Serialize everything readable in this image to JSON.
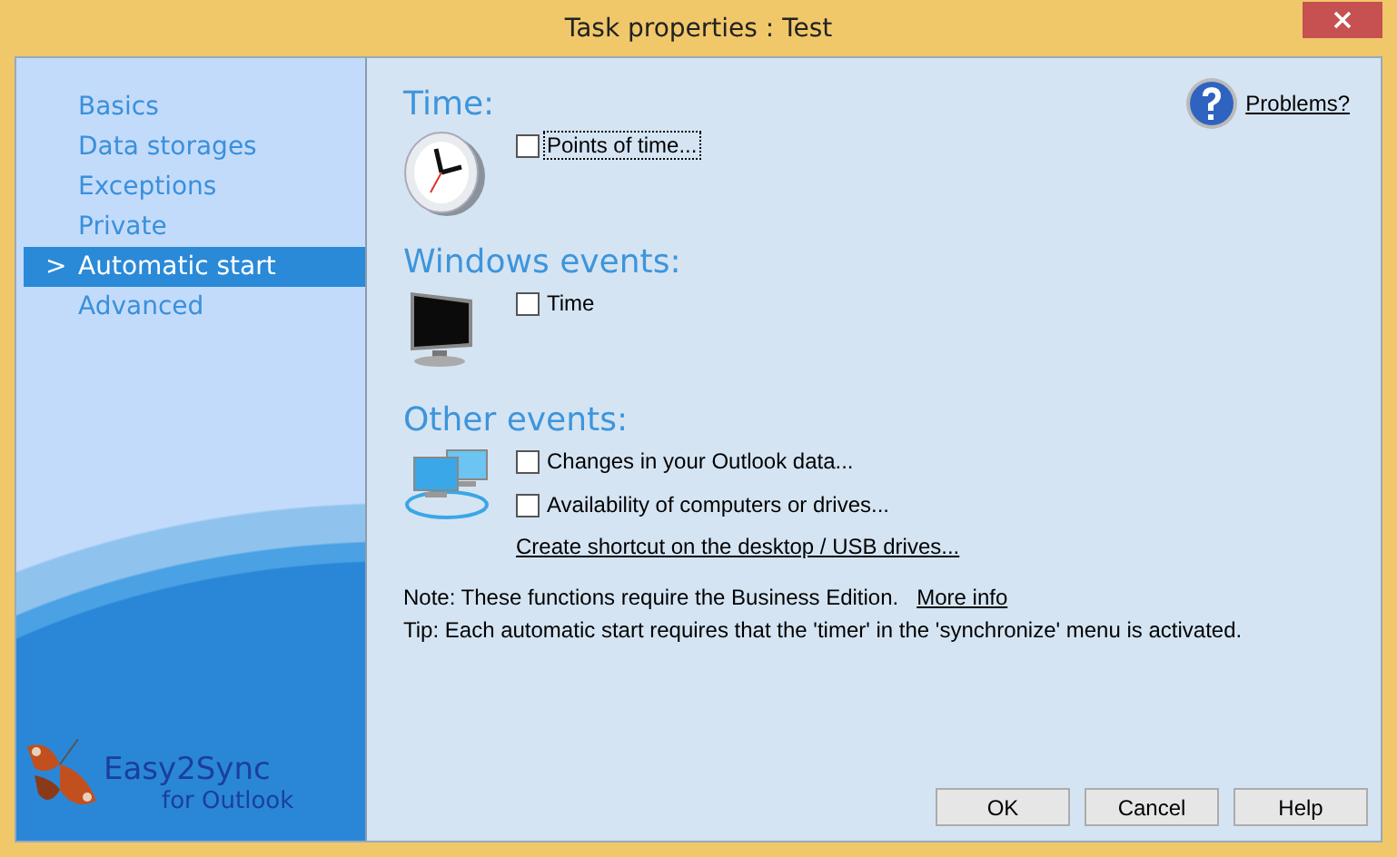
{
  "window": {
    "title": "Task properties : Test"
  },
  "sidebar": {
    "selected_marker": ">",
    "items": [
      {
        "label": "Basics",
        "selected": false
      },
      {
        "label": "Data storages",
        "selected": false
      },
      {
        "label": "Exceptions",
        "selected": false
      },
      {
        "label": "Private",
        "selected": false
      },
      {
        "label": "Automatic start",
        "selected": true
      },
      {
        "label": "Advanced",
        "selected": false
      }
    ],
    "logo": {
      "name": "Easy2Sync",
      "subtitle": "for Outlook"
    }
  },
  "help_link": "Problems?",
  "sections": [
    {
      "title": "Time:",
      "kind": "clock",
      "options": [
        {
          "label": "Points of time...",
          "checked": false,
          "focused": true
        }
      ]
    },
    {
      "title": "Windows events:",
      "kind": "monitor",
      "options": [
        {
          "label": "Time",
          "checked": false,
          "focused": false
        }
      ]
    },
    {
      "title": "Other events:",
      "kind": "network",
      "options": [
        {
          "label": "Changes in your Outlook data...",
          "checked": false,
          "focused": false
        },
        {
          "label": "Availability of computers or drives...",
          "checked": false,
          "focused": false
        }
      ],
      "link": "Create shortcut on the desktop / USB drives..."
    }
  ],
  "note": {
    "text": "Note: These functions require the Business Edition.",
    "link": "More info"
  },
  "tip": "Tip: Each automatic start requires that the 'timer' in the 'synchronize' menu is activated.",
  "buttons": [
    "OK",
    "Cancel",
    "Help"
  ]
}
